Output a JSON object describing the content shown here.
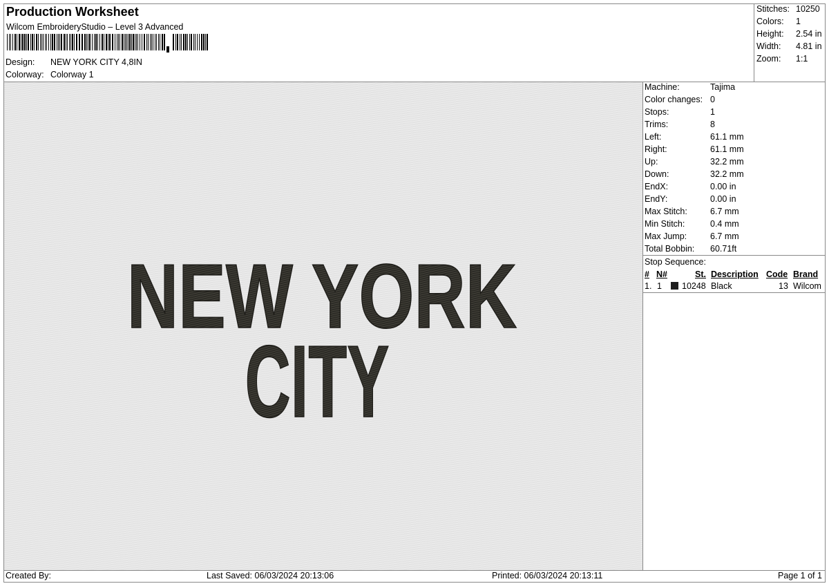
{
  "header": {
    "title": "Production Worksheet",
    "software": "Wilcom EmbroideryStudio – Level 3 Advanced",
    "design_label": "Design:",
    "design_value": "NEW YORK CITY 4,8IN",
    "colorway_label": "Colorway:",
    "colorway_value": "Colorway 1"
  },
  "summary": [
    {
      "label": "Stitches:",
      "value": "10250"
    },
    {
      "label": "Colors:",
      "value": "1"
    },
    {
      "label": "Height:",
      "value": "2.54 in"
    },
    {
      "label": "Width:",
      "value": "4.81 in"
    },
    {
      "label": "Zoom:",
      "value": "1:1"
    }
  ],
  "design_preview": {
    "line1": "NEW YORK",
    "line2": "CITY",
    "thread_color": "#2b2a25",
    "background_color": "#e3e3e3"
  },
  "machine_info": [
    {
      "label": "Machine:",
      "value": "Tajima"
    },
    {
      "label": "Color changes:",
      "value": "0"
    },
    {
      "label": "Stops:",
      "value": "1"
    },
    {
      "label": "Trims:",
      "value": "8"
    },
    {
      "label": "Left:",
      "value": "61.1 mm"
    },
    {
      "label": "Right:",
      "value": "61.1 mm"
    },
    {
      "label": "Up:",
      "value": "32.2 mm"
    },
    {
      "label": "Down:",
      "value": "32.2 mm"
    },
    {
      "label": "EndX:",
      "value": "0.00 in"
    },
    {
      "label": "EndY:",
      "value": "0.00 in"
    },
    {
      "label": "Max Stitch:",
      "value": "6.7 mm"
    },
    {
      "label": "Min Stitch:",
      "value": "0.4 mm"
    },
    {
      "label": "Max Jump:",
      "value": "6.7 mm"
    },
    {
      "label": "Total Bobbin:",
      "value": "60.71ft"
    }
  ],
  "stop_sequence": {
    "title": "Stop Sequence:",
    "columns": {
      "num": "#",
      "n": "N#",
      "st": "St.",
      "description": "Description",
      "code": "Code",
      "brand": "Brand"
    },
    "rows": [
      {
        "num": "1.",
        "n": "1",
        "swatch_color": "#1e1e1e",
        "st": "10248",
        "description": "Black",
        "code": "13",
        "brand": "Wilcom"
      }
    ]
  },
  "footer": {
    "created_by": "Created By:",
    "last_saved": "Last Saved: 06/03/2024 20:13:06",
    "printed": "Printed: 06/03/2024 20:13:11",
    "page": "Page 1 of 1"
  }
}
